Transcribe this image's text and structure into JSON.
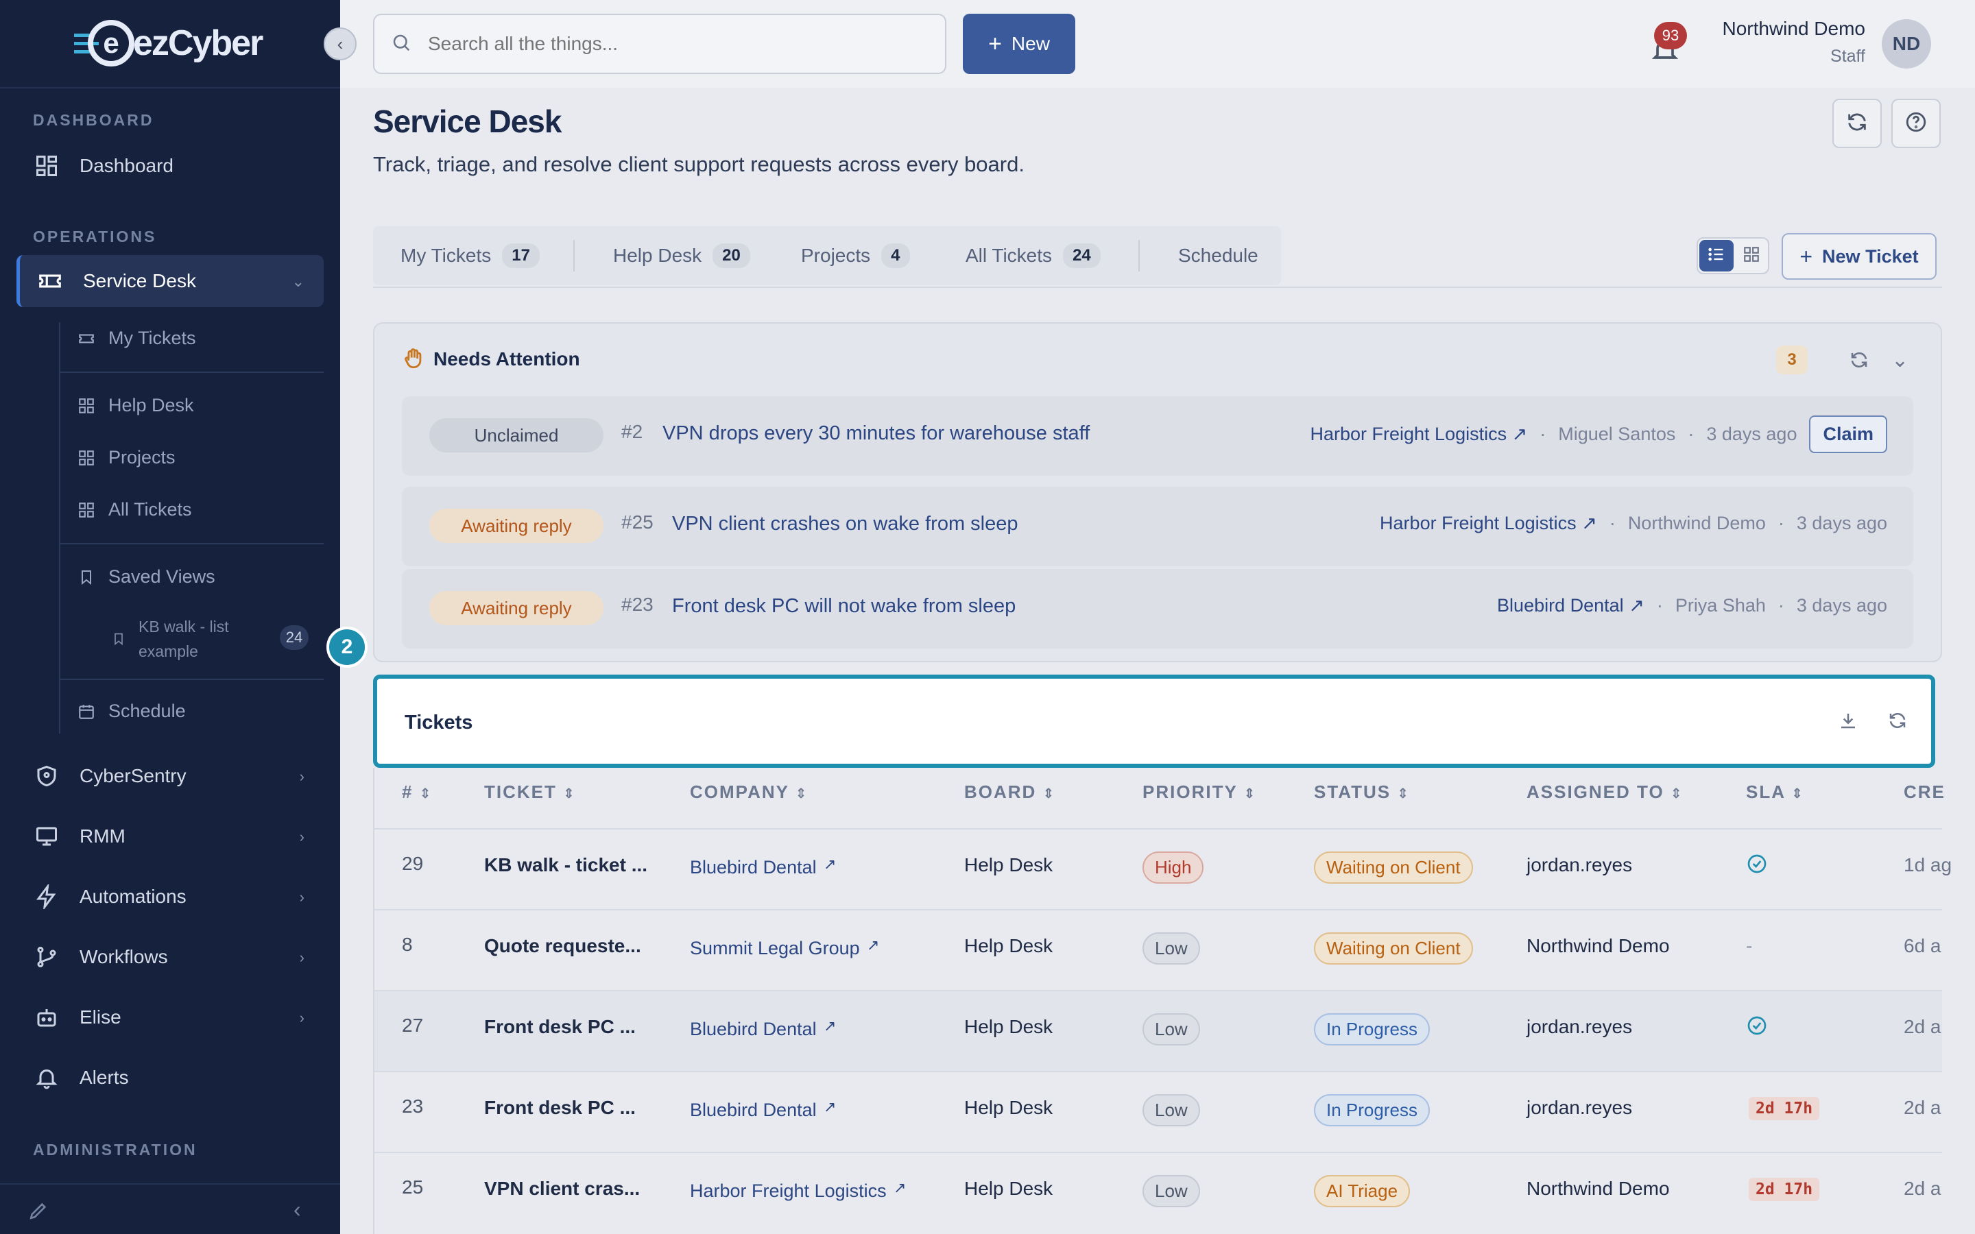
{
  "app": {
    "brand": "ezCyber"
  },
  "sidebar": {
    "sections": {
      "dashboard": "DASHBOARD",
      "operations": "OPERATIONS",
      "administration": "ADMINISTRATION"
    },
    "items": {
      "dashboard": "Dashboard",
      "service_desk": "Service Desk",
      "cybersentry": "CyberSentry",
      "rmm": "RMM",
      "automations": "Automations",
      "workflows": "Workflows",
      "elise": "Elise",
      "alerts": "Alerts"
    },
    "sub_items": {
      "my_tickets": "My Tickets",
      "help_desk": "Help Desk",
      "projects": "Projects",
      "all_tickets": "All Tickets",
      "saved_views": "Saved Views",
      "saved_view_1": "KB walk - list",
      "saved_view_1b": "example",
      "saved_view_1_count": "24",
      "schedule": "Schedule"
    }
  },
  "topbar": {
    "search_placeholder": "Search all the things...",
    "new_label": "New",
    "notif_count": "93",
    "user_name": "Northwind Demo",
    "user_role": "Staff",
    "avatar_initials": "ND"
  },
  "page": {
    "title": "Service Desk",
    "subtitle": "Track, triage, and resolve client support requests across every board."
  },
  "tabs": [
    {
      "label": "My Tickets",
      "count": "17"
    },
    {
      "label": "Help Desk",
      "count": "20"
    },
    {
      "label": "Projects",
      "count": "4"
    },
    {
      "label": "All Tickets",
      "count": "24"
    },
    {
      "label": "Schedule"
    }
  ],
  "new_ticket_label": "New Ticket",
  "attention": {
    "title": "Needs Attention",
    "count": "3",
    "rows": [
      {
        "status": "Unclaimed",
        "num": "#2",
        "subject": "VPN drops every 30 minutes for warehouse staff",
        "company": "Harbor Freight Logistics",
        "person": "Miguel Santos",
        "when": "3 days ago",
        "action": "Claim"
      },
      {
        "status": "Awaiting reply",
        "num": "#25",
        "subject": "VPN client crashes on wake from sleep",
        "company": "Harbor Freight Logistics",
        "person": "Northwind Demo",
        "when": "3 days ago"
      },
      {
        "status": "Awaiting reply",
        "num": "#23",
        "subject": "Front desk PC will not wake from sleep",
        "company": "Bluebird Dental",
        "person": "Priya Shah",
        "when": "3 days ago"
      }
    ]
  },
  "step_badge": "2",
  "tickets": {
    "title": "Tickets",
    "columns": [
      "#",
      "TICKET",
      "COMPANY",
      "BOARD",
      "PRIORITY",
      "STATUS",
      "ASSIGNED TO",
      "SLA",
      "CRE"
    ],
    "rows": [
      {
        "num": "29",
        "ticket": "KB walk - ticket ...",
        "company": "Bluebird Dental",
        "board": "Help Desk",
        "priority": "High",
        "status": "Waiting on Client",
        "assigned": "jordan.reyes",
        "sla": "check",
        "created": "1d ag"
      },
      {
        "num": "8",
        "ticket": "Quote requeste...",
        "company": "Summit Legal Group",
        "board": "Help Desk",
        "priority": "Low",
        "status": "Waiting on Client",
        "assigned": "Northwind Demo",
        "sla": "-",
        "created": "6d a"
      },
      {
        "num": "27",
        "ticket": "Front desk PC ...",
        "company": "Bluebird Dental",
        "board": "Help Desk",
        "priority": "Low",
        "status": "In Progress",
        "assigned": "jordan.reyes",
        "sla": "check",
        "created": "2d a"
      },
      {
        "num": "23",
        "ticket": "Front desk PC ...",
        "company": "Bluebird Dental",
        "board": "Help Desk",
        "priority": "Low",
        "status": "In Progress",
        "assigned": "jordan.reyes",
        "sla": "2d 17h",
        "created": "2d a"
      },
      {
        "num": "25",
        "ticket": "VPN client cras...",
        "company": "Harbor Freight Logistics",
        "board": "Help Desk",
        "priority": "Low",
        "status": "AI Triage",
        "assigned": "Northwind Demo",
        "sla": "2d 17h",
        "created": "2d a"
      }
    ]
  },
  "colors": {
    "accent": "#3a5a9c",
    "highlight": "#1f8fb0",
    "sidebar": "#16223d"
  }
}
